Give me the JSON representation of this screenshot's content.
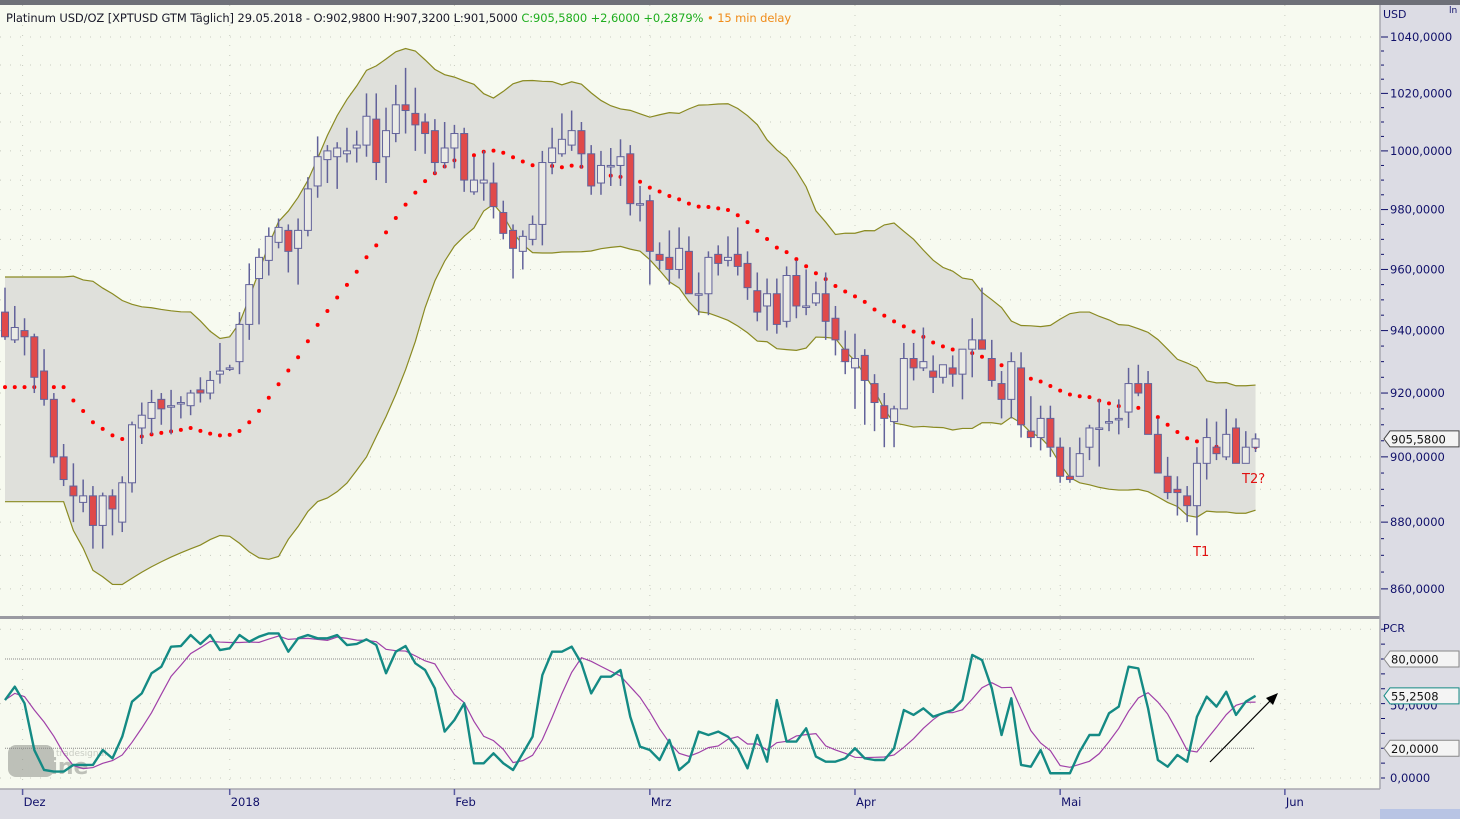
{
  "header": {
    "title": "Platinum USD/OZ [XPTUSD GTM Täglich] 29.05.2018 - O:902,9800 H:907,3200 L:901,5000",
    "close_change": "C:905,5800 +2,6000 +0,2879%",
    "delay": "• 15 min delay"
  },
  "colors": {
    "background": "#f7faf0",
    "axis_bg": "#dcdce4",
    "up_fill": "#ebebe6",
    "down_fill": "#e04a4a",
    "candle_stroke": "#62629a",
    "band_fill": "#dfe0db",
    "band_line": "#8a8a22",
    "ma_dots": "#ff0000",
    "pcr_line": "#148a84",
    "pcr_signal": "#a040a8",
    "axis_text": "#10106a",
    "annotation": "#e01010"
  },
  "logo_text": "tradesignal online",
  "annotations": {
    "t1": "T1",
    "t2": "T2?"
  },
  "chart_data": [
    {
      "type": "candlestick",
      "title": "Platinum USD/OZ [XPTUSD GTM Täglich]",
      "y_unit": "USD",
      "ylim": [
        855,
        1045
      ],
      "y_scale": "log",
      "y_ticks": [
        1040,
        1020,
        1000,
        980,
        960,
        940,
        920,
        900,
        880,
        860
      ],
      "y_tick_labels": [
        "1040,0000",
        "1020,0000",
        "1000,0000",
        "980,0000",
        "960,0000",
        "940,0000",
        "920,0000",
        "900,0000",
        "880,0000",
        "860,0000"
      ],
      "last_price": 905.58,
      "last_price_label": "905,5800",
      "x_labels": [
        "Dez",
        "2018",
        "Feb",
        "Mrz",
        "Apr",
        "Mai",
        "Jun"
      ],
      "x_label_bar_index": [
        1.8,
        23,
        46,
        66,
        87,
        108,
        131
      ],
      "overlays": {
        "bollinger_period": 20,
        "bollinger_stddev": 2,
        "moving_average_period": 20
      },
      "ohlc": [
        [
          946,
          954,
          937,
          938
        ],
        [
          937,
          948,
          936,
          941
        ],
        [
          940,
          944,
          932,
          938
        ],
        [
          938,
          939,
          920,
          925
        ],
        [
          927,
          934,
          916,
          918
        ],
        [
          918,
          920,
          898,
          900
        ],
        [
          900,
          904,
          891,
          893
        ],
        [
          891,
          898,
          880,
          888
        ],
        [
          886,
          893,
          883,
          888
        ],
        [
          888,
          891,
          872,
          879
        ],
        [
          879,
          889,
          872,
          888
        ],
        [
          888,
          890,
          876,
          884
        ],
        [
          880,
          894,
          877,
          892
        ],
        [
          892,
          911,
          889,
          910
        ],
        [
          909,
          917,
          904,
          913
        ],
        [
          912,
          921,
          907,
          917
        ],
        [
          918,
          920,
          910,
          915
        ],
        [
          916,
          921,
          907,
          916
        ],
        [
          917,
          919,
          912,
          917
        ],
        [
          916,
          921,
          913,
          920
        ],
        [
          921,
          925,
          917,
          920
        ],
        [
          920,
          927,
          918,
          924
        ],
        [
          926,
          936,
          923,
          927
        ],
        [
          928,
          929,
          927,
          928
        ],
        [
          930,
          946,
          926,
          942
        ],
        [
          942,
          962,
          937,
          955
        ],
        [
          957,
          967,
          942,
          964
        ],
        [
          963,
          974,
          958,
          971
        ],
        [
          969,
          977,
          967,
          974
        ],
        [
          973,
          975,
          959,
          966
        ],
        [
          967,
          977,
          955,
          973
        ],
        [
          973,
          991,
          971,
          987
        ],
        [
          988,
          1005,
          984,
          998
        ],
        [
          997,
          1002,
          989,
          1000
        ],
        [
          998,
          1003,
          987,
          1001
        ],
        [
          999,
          1008,
          996,
          1000
        ],
        [
          1001,
          1007,
          996,
          1002
        ],
        [
          1002,
          1020,
          998,
          1012
        ],
        [
          1011,
          1020,
          990,
          996
        ],
        [
          998,
          1015,
          989,
          1007
        ],
        [
          1006,
          1023,
          1003,
          1016
        ],
        [
          1016,
          1029,
          1006,
          1014
        ],
        [
          1013,
          1022,
          1000,
          1009
        ],
        [
          1010,
          1013,
          999,
          1006
        ],
        [
          1007,
          1011,
          992,
          996
        ],
        [
          996,
          1010,
          994,
          1001
        ],
        [
          1001,
          1009,
          994,
          1006
        ],
        [
          1006,
          1008,
          986,
          990
        ],
        [
          986,
          998,
          985,
          990
        ],
        [
          989,
          1000,
          983,
          990
        ],
        [
          989,
          996,
          977,
          981
        ],
        [
          979,
          983,
          970,
          972
        ],
        [
          973,
          975,
          957,
          967
        ],
        [
          966,
          973,
          960,
          971
        ],
        [
          970,
          978,
          968,
          975
        ],
        [
          975,
          1000,
          968,
          996
        ],
        [
          996,
          1008,
          992,
          1001
        ],
        [
          999,
          1013,
          998,
          1004
        ],
        [
          1002,
          1014,
          1000,
          1007
        ],
        [
          1007,
          1010,
          994,
          999
        ],
        [
          999,
          1002,
          985,
          988
        ],
        [
          989,
          1000,
          985,
          995
        ],
        [
          995,
          1001,
          988,
          995
        ],
        [
          995,
          1004,
          988,
          998
        ],
        [
          999,
          1002,
          978,
          982
        ],
        [
          982,
          988,
          976,
          982
        ],
        [
          983,
          985,
          955,
          966
        ],
        [
          965,
          969,
          960,
          963
        ],
        [
          964,
          973,
          955,
          960
        ],
        [
          960,
          974,
          957,
          967
        ],
        [
          966,
          971,
          952,
          952
        ],
        [
          952,
          959,
          945,
          952
        ],
        [
          952,
          966,
          945,
          964
        ],
        [
          965,
          968,
          958,
          962
        ],
        [
          963,
          971,
          961,
          964
        ],
        [
          965,
          974,
          958,
          961
        ],
        [
          962,
          966,
          950,
          954
        ],
        [
          953,
          959,
          943,
          946
        ],
        [
          948,
          957,
          940,
          952
        ],
        [
          952,
          957,
          939,
          942
        ],
        [
          943,
          961,
          941,
          958
        ],
        [
          958,
          963,
          944,
          948
        ],
        [
          948,
          960,
          945,
          948
        ],
        [
          949,
          956,
          948,
          952
        ],
        [
          952,
          959,
          937,
          943
        ],
        [
          944,
          948,
          932,
          937
        ],
        [
          934,
          940,
          926,
          930
        ],
        [
          928,
          939,
          915,
          931
        ],
        [
          932,
          934,
          910,
          924
        ],
        [
          923,
          926,
          908,
          917
        ],
        [
          916,
          920,
          903,
          912
        ],
        [
          911,
          916,
          903,
          915
        ],
        [
          915,
          936,
          915,
          931
        ],
        [
          931,
          936,
          924,
          928
        ],
        [
          928,
          941,
          927,
          930
        ],
        [
          927,
          932,
          920,
          925
        ],
        [
          925,
          929,
          923,
          929
        ],
        [
          928,
          932,
          922,
          926
        ],
        [
          926,
          934,
          918,
          934
        ],
        [
          934,
          944,
          925,
          937
        ],
        [
          937,
          954,
          934,
          934
        ],
        [
          931,
          937,
          922,
          924
        ],
        [
          923,
          927,
          912,
          918
        ],
        [
          918,
          933,
          912,
          930
        ],
        [
          928,
          933,
          906,
          910
        ],
        [
          908,
          919,
          903,
          906
        ],
        [
          906,
          916,
          902,
          912
        ],
        [
          912,
          916,
          900,
          903
        ],
        [
          903,
          906,
          892,
          894
        ],
        [
          894,
          903,
          892,
          893
        ],
        [
          894,
          906,
          894,
          901
        ],
        [
          903,
          910,
          899,
          909
        ],
        [
          909,
          918,
          897,
          909
        ],
        [
          911,
          915,
          908,
          911
        ],
        [
          912,
          918,
          907,
          912
        ],
        [
          914,
          928,
          909,
          923
        ],
        [
          923,
          929,
          919,
          920
        ],
        [
          923,
          927,
          907,
          907
        ],
        [
          907,
          912,
          895,
          895
        ],
        [
          894,
          900,
          887,
          889
        ],
        [
          890,
          894,
          882,
          889
        ],
        [
          888,
          891,
          880,
          885
        ],
        [
          885,
          903,
          876,
          898
        ],
        [
          898,
          912,
          893,
          906
        ],
        [
          903,
          911,
          899,
          901
        ],
        [
          900,
          915,
          899,
          907
        ],
        [
          909,
          912,
          898,
          898
        ],
        [
          898,
          908,
          898,
          903
        ],
        [
          902.98,
          907.32,
          901.5,
          905.58
        ]
      ]
    },
    {
      "type": "line",
      "title": "PCR",
      "ylim": [
        0,
        100
      ],
      "y_ticks": [
        80,
        20,
        0
      ],
      "y_tick_labels": [
        "80,0000",
        "20,0000",
        "0,0000"
      ],
      "hidden_tick_label": "50,0000",
      "reference_lines": [
        80,
        20
      ],
      "last_value": 55.2508,
      "last_value_label": "55,2508",
      "signal_period": 5,
      "values": [
        52.4,
        61.4,
        50.2,
        18.8,
        5.4,
        4.3,
        4.3,
        8.8,
        8.8,
        8.8,
        18.8,
        13.2,
        27.8,
        51.3,
        56.9,
        70.4,
        74.8,
        88.3,
        88.7,
        96.1,
        90.1,
        96.1,
        86,
        87.2,
        96.1,
        91.6,
        95,
        97.2,
        97.2,
        84.9,
        93.9,
        96.1,
        93.9,
        93.9,
        96.1,
        89.4,
        90.1,
        93.2,
        89.4,
        70.4,
        84.9,
        88.7,
        77.1,
        72.6,
        60.3,
        31.2,
        39,
        50.2,
        9.9,
        9.9,
        16.6,
        9.9,
        5.4,
        16.6,
        27.8,
        69.2,
        84.9,
        84.9,
        88.3,
        77.1,
        56.9,
        68.1,
        68.1,
        72.6,
        41.2,
        21.1,
        18.8,
        12.1,
        25.6,
        5.4,
        11,
        31.2,
        28.9,
        31.2,
        27.8,
        20,
        6.5,
        28.9,
        11,
        52.4,
        24.5,
        24.5,
        33.4,
        14.4,
        11,
        11,
        13.2,
        20,
        13.2,
        12.1,
        12.1,
        20,
        45.7,
        42.4,
        46.8,
        41.2,
        43.5,
        45.7,
        52.4,
        82.7,
        79.3,
        60.3,
        28.9,
        53.6,
        8.8,
        7.6,
        18.8,
        3.2,
        3.2,
        3.2,
        17.7,
        28.9,
        28.9,
        43.5,
        48,
        74.8,
        73.7,
        46.8,
        12.1,
        7.6,
        15.5,
        11,
        41.2,
        54.7,
        48,
        58,
        42.4,
        51.3,
        55.25
      ]
    }
  ]
}
